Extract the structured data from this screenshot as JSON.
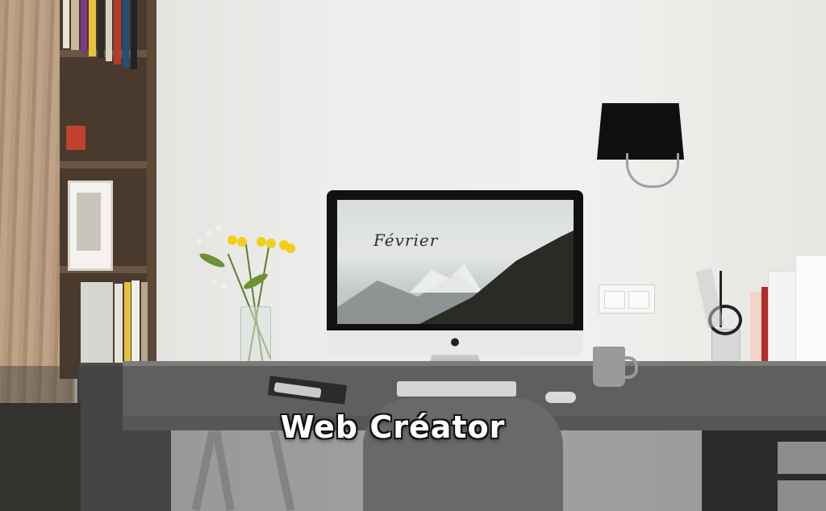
{
  "banner": {
    "title": "Web Créator"
  },
  "screen": {
    "wallpaper_text": "Février"
  },
  "icons": {
    "apple_logo": "apple-logo-icon"
  }
}
